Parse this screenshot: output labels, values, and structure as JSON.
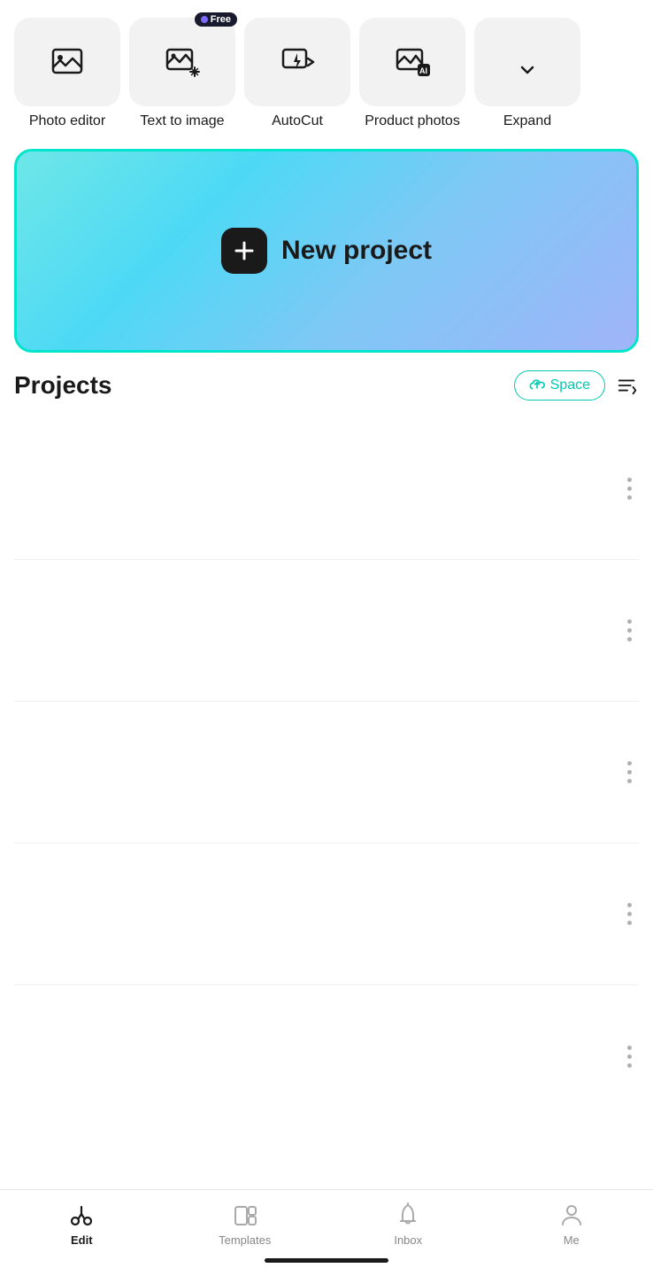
{
  "toolbar": {
    "items": [
      {
        "id": "photo-editor",
        "label": "Photo editor",
        "icon": "photo-editor-icon",
        "free": false
      },
      {
        "id": "text-to-image",
        "label": "Text to image",
        "icon": "text-to-image-icon",
        "free": true
      },
      {
        "id": "autocut",
        "label": "AutoCut",
        "icon": "autocut-icon",
        "free": false
      },
      {
        "id": "product-photos",
        "label": "Product photos",
        "icon": "product-photos-icon",
        "free": false
      },
      {
        "id": "expand",
        "label": "Expand",
        "icon": "expand-icon",
        "free": false
      }
    ],
    "free_badge_label": "Free"
  },
  "new_project": {
    "label": "New project",
    "icon": "plus-icon"
  },
  "projects": {
    "title": "Projects",
    "space_button_label": "Space",
    "row_count": 5
  },
  "bottom_nav": {
    "items": [
      {
        "id": "edit",
        "label": "Edit",
        "icon": "scissors-icon",
        "active": true
      },
      {
        "id": "templates",
        "label": "Templates",
        "icon": "templates-icon",
        "active": false
      },
      {
        "id": "inbox",
        "label": "Inbox",
        "icon": "bell-icon",
        "active": false
      },
      {
        "id": "me",
        "label": "Me",
        "icon": "person-icon",
        "active": false
      }
    ]
  }
}
